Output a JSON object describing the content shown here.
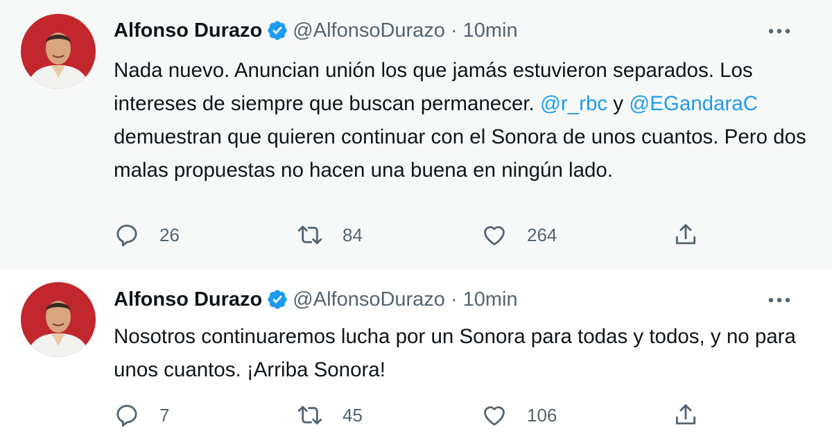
{
  "colors": {
    "accent": "#1d9bf0",
    "text": "#0f1419",
    "muted": "#536471",
    "thread_line": "#cfd9de",
    "avatar_bg": "#c1272d"
  },
  "tweets": [
    {
      "author_name": "Alfonso Durazo",
      "handle": "@AlfonsoDurazo",
      "separator": "·",
      "time": "10min",
      "verified_icon": "verified-badge-icon",
      "more_icon": "more-options-icon",
      "text_parts": {
        "p1": "Nada nuevo. Anuncian unión los que jamás estuvieron separados. Los intereses de siempre que buscan permanecer. ",
        "mention1": "@r_rbc",
        "p2": " y ",
        "mention2": "@EGandaraC",
        "p3": " demuestran que quieren continuar con el Sonora de unos cuantos. Pero dos malas propuestas no hacen una buena en ningún lado."
      },
      "replies": "26",
      "retweets": "84",
      "likes": "264"
    },
    {
      "author_name": "Alfonso Durazo",
      "handle": "@AlfonsoDurazo",
      "separator": "·",
      "time": "10min",
      "verified_icon": "verified-badge-icon",
      "more_icon": "more-options-icon",
      "text": "Nosotros continuaremos lucha por un Sonora para todas y todos, y no para unos cuantos. ¡Arriba Sonora!",
      "replies": "7",
      "retweets": "45",
      "likes": "106"
    }
  ]
}
